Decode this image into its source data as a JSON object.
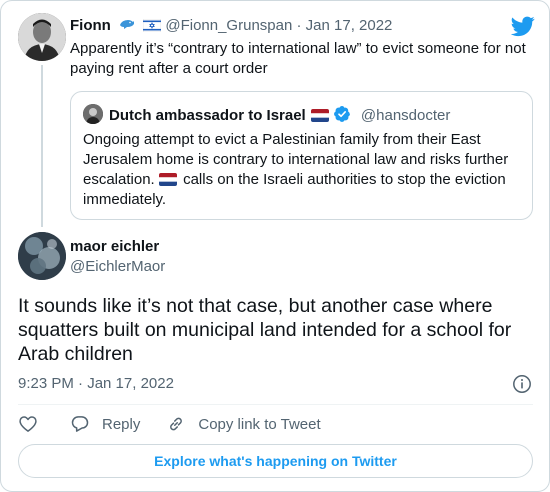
{
  "parent_tweet": {
    "name": "Fionn",
    "name_emojis": [
      "dolphin",
      "israel-flag"
    ],
    "handle": "@Fionn_Grunspan",
    "separator": "·",
    "date": "Jan 17, 2022",
    "text": "Apparently it’s “contrary to international law” to evict someone for not paying rent after a court order"
  },
  "quoted_tweet": {
    "name": "Dutch ambassador to Israel",
    "name_badges": [
      "netherlands-flag",
      "verified-badge"
    ],
    "handle": "@hansdocter",
    "text_before_flag": "Ongoing attempt to evict a Palestinian family from their East Jerusalem home is contrary to international law and risks further escalation.",
    "text_after_flag": "calls on the Israeli authorities to stop the eviction immediately."
  },
  "main_tweet": {
    "name": "maor eichler",
    "handle": "@EichlerMaor",
    "text": "It sounds like it’s not that case, but another case where squatters built on municipal land intended for a school for Arab children",
    "timestamp": "9:23 PM · Jan 17, 2022"
  },
  "actions": {
    "reply_label": "Reply",
    "copy_link_label": "Copy link to Tweet"
  },
  "footer": {
    "explore_label": "Explore what's happening on Twitter"
  },
  "colors": {
    "accent": "#1d9bf0",
    "secondary_text": "#536471",
    "border": "#cfd9de"
  }
}
